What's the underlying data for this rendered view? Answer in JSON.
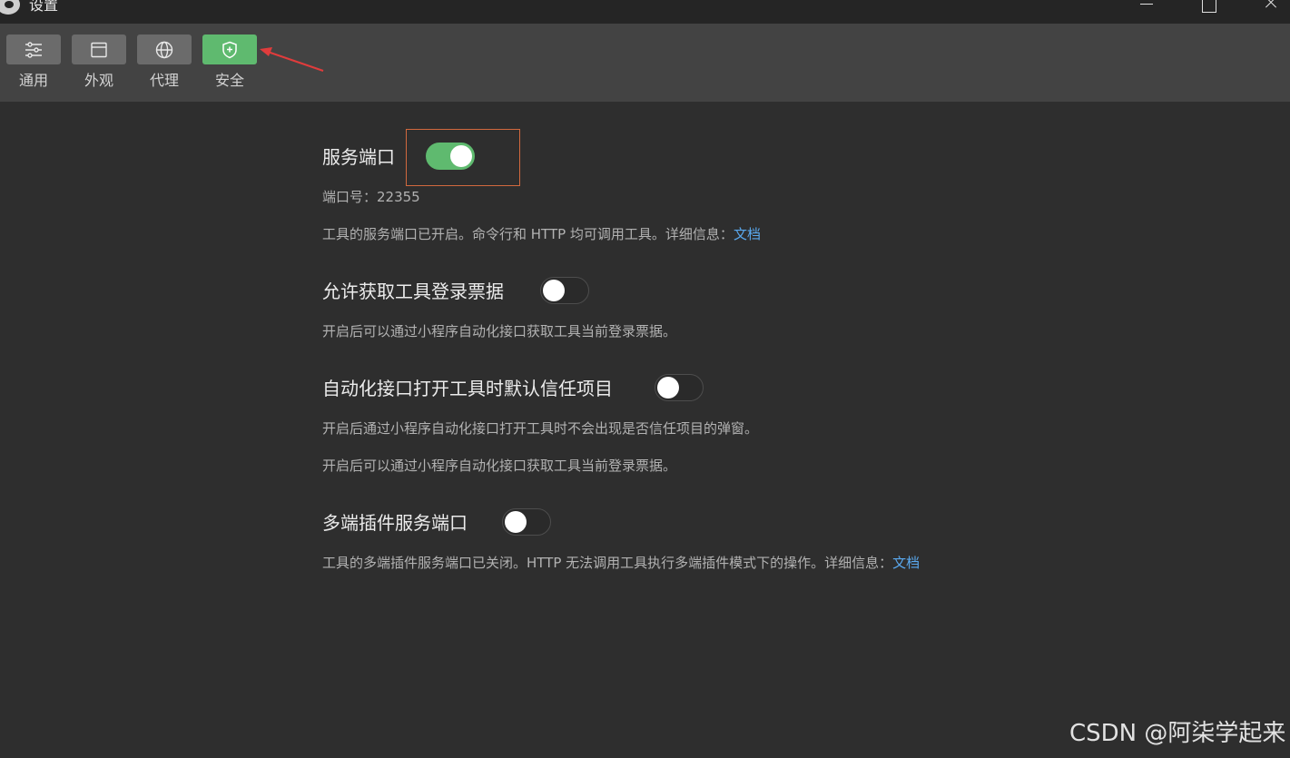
{
  "window": {
    "title": "设置"
  },
  "toolbar": {
    "tabs": [
      {
        "label": "通用",
        "icon": "sliders-icon",
        "active": false
      },
      {
        "label": "外观",
        "icon": "window-icon",
        "active": false
      },
      {
        "label": "代理",
        "icon": "globe-icon",
        "active": false
      },
      {
        "label": "安全",
        "icon": "shield-icon",
        "active": true
      }
    ]
  },
  "settings": {
    "service_port": {
      "title": "服务端口",
      "enabled": true,
      "port_label": "端口号：22355",
      "description": "工具的服务端口已开启。命令行和 HTTP 均可调用工具。详细信息：",
      "link": "文档"
    },
    "login_ticket": {
      "title": "允许获取工具登录票据",
      "enabled": false,
      "description": "开启后可以通过小程序自动化接口获取工具当前登录票据。"
    },
    "trust_project": {
      "title": "自动化接口打开工具时默认信任项目",
      "enabled": false,
      "description1": "开启后通过小程序自动化接口打开工具时不会出现是否信任项目的弹窗。",
      "description2": "开启后可以通过小程序自动化接口获取工具当前登录票据。"
    },
    "multi_plugin": {
      "title": "多端插件服务端口",
      "enabled": false,
      "description": "工具的多端插件服务端口已关闭。HTTP 无法调用工具执行多端插件模式下的操作。详细信息：",
      "link": "文档"
    }
  },
  "watermark": "CSDN @阿柒学起来",
  "colors": {
    "accent": "#5fba6f",
    "link": "#5aa9ef",
    "highlight": "#d2693e",
    "arrow": "#e03c3c"
  }
}
